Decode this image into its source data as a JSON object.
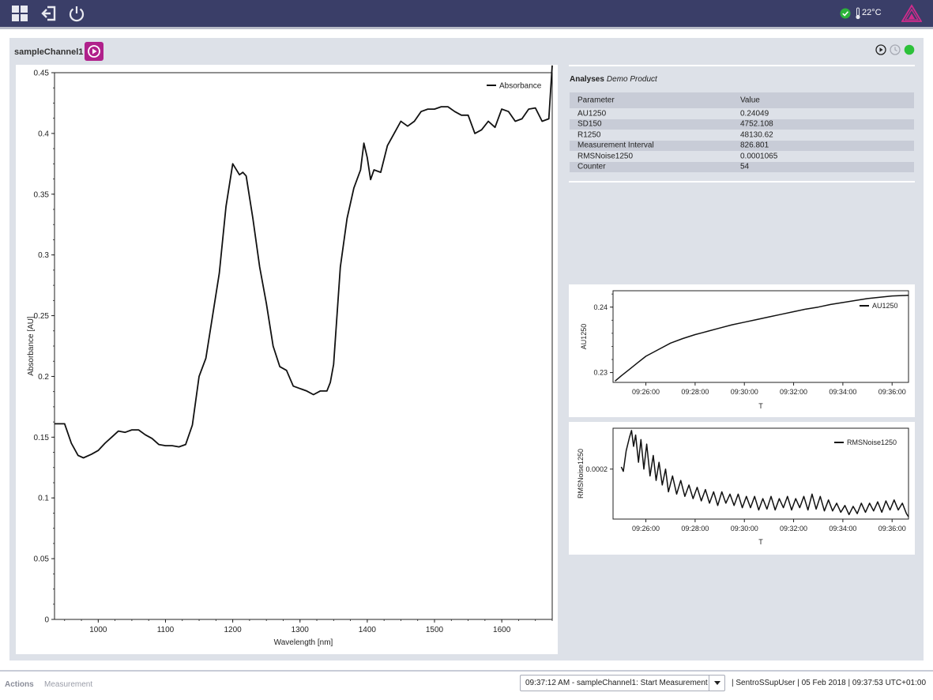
{
  "header": {
    "temperature": "22°C",
    "icons": [
      "dashboard-icon",
      "logout-icon",
      "power-icon",
      "status-ok-icon",
      "thermometer-icon",
      "brand-logo-icon"
    ]
  },
  "channel": {
    "name": "sampleChannel1"
  },
  "analyses": {
    "title": "Analyses",
    "product": "Demo Product",
    "columns": [
      "Parameter",
      "Value"
    ],
    "rows": [
      {
        "parameter": "AU1250",
        "value": "0.24049"
      },
      {
        "parameter": "SD150",
        "value": "4752.108"
      },
      {
        "parameter": "R1250",
        "value": "48130.62"
      },
      {
        "parameter": "Measurement Interval",
        "value": "826.801"
      },
      {
        "parameter": "RMSNoise1250",
        "value": "0.0001065"
      },
      {
        "parameter": "Counter",
        "value": "54"
      }
    ]
  },
  "chart_data": [
    {
      "type": "line",
      "xlabel": "Wavelength [nm]",
      "ylabel": "Absorbance [AU]",
      "legend": "top-right",
      "xlim": [
        935,
        1675
      ],
      "ylim": [
        0,
        0.45
      ],
      "xticks": [
        "1000",
        "1100",
        "1200",
        "1300",
        "1400",
        "1500",
        "1600"
      ],
      "yticks": [
        "0",
        "0.05",
        "0.1",
        "0.15",
        "0.2",
        "0.25",
        "0.3",
        "0.35",
        "0.4",
        "0.45"
      ],
      "series": [
        {
          "name": "Absorbance",
          "x": [
            935,
            950,
            960,
            970,
            978,
            990,
            1000,
            1010,
            1020,
            1030,
            1040,
            1050,
            1060,
            1070,
            1080,
            1090,
            1100,
            1110,
            1120,
            1130,
            1140,
            1150,
            1160,
            1170,
            1180,
            1190,
            1200,
            1210,
            1215,
            1220,
            1230,
            1240,
            1250,
            1260,
            1270,
            1280,
            1290,
            1300,
            1310,
            1320,
            1330,
            1340,
            1345,
            1350,
            1360,
            1370,
            1380,
            1390,
            1395,
            1400,
            1405,
            1410,
            1420,
            1430,
            1440,
            1450,
            1460,
            1470,
            1480,
            1490,
            1500,
            1510,
            1520,
            1530,
            1540,
            1550,
            1560,
            1570,
            1580,
            1590,
            1600,
            1610,
            1620,
            1630,
            1640,
            1650,
            1660,
            1670,
            1675
          ],
          "y": [
            0.161,
            0.161,
            0.145,
            0.135,
            0.133,
            0.136,
            0.139,
            0.145,
            0.15,
            0.155,
            0.154,
            0.156,
            0.156,
            0.152,
            0.149,
            0.144,
            0.143,
            0.143,
            0.142,
            0.144,
            0.16,
            0.2,
            0.215,
            0.25,
            0.285,
            0.34,
            0.375,
            0.366,
            0.368,
            0.365,
            0.33,
            0.29,
            0.26,
            0.225,
            0.208,
            0.205,
            0.192,
            0.19,
            0.188,
            0.185,
            0.188,
            0.188,
            0.195,
            0.21,
            0.29,
            0.33,
            0.355,
            0.37,
            0.392,
            0.38,
            0.362,
            0.37,
            0.368,
            0.39,
            0.4,
            0.41,
            0.406,
            0.41,
            0.418,
            0.42,
            0.42,
            0.422,
            0.422,
            0.418,
            0.415,
            0.415,
            0.4,
            0.403,
            0.41,
            0.405,
            0.42,
            0.418,
            0.41,
            0.412,
            0.42,
            0.421,
            0.41,
            0.412,
            0.456
          ]
        }
      ]
    },
    {
      "type": "line",
      "xlabel": "T",
      "ylabel": "AU1250",
      "legend": "top-right",
      "xlim": [
        "09:24:40",
        "09:36:40"
      ],
      "ylim": [
        0.2285,
        0.2425
      ],
      "xticks": [
        "09:26:00",
        "09:28:00",
        "09:30:00",
        "09:32:00",
        "09:34:00",
        "09:36:00"
      ],
      "yticks": [
        "0.23",
        "0.24"
      ],
      "series": [
        {
          "name": "AU1250",
          "x": [
            "09:24:45",
            "09:25:00",
            "09:25:20",
            "09:25:40",
            "09:26:00",
            "09:26:30",
            "09:27:00",
            "09:27:30",
            "09:28:00",
            "09:28:30",
            "09:29:00",
            "09:29:30",
            "09:30:00",
            "09:30:30",
            "09:31:00",
            "09:31:30",
            "09:32:00",
            "09:32:30",
            "09:33:00",
            "09:33:30",
            "09:34:00",
            "09:34:30",
            "09:35:00",
            "09:35:30",
            "09:36:00",
            "09:36:40"
          ],
          "y": [
            0.2287,
            0.2295,
            0.2305,
            0.2315,
            0.2325,
            0.2335,
            0.2345,
            0.2352,
            0.2358,
            0.2363,
            0.2368,
            0.2373,
            0.2377,
            0.2381,
            0.2385,
            0.2389,
            0.2393,
            0.2397,
            0.24,
            0.2404,
            0.2407,
            0.241,
            0.2413,
            0.2415,
            0.2417,
            0.2418
          ]
        }
      ]
    },
    {
      "type": "line",
      "xlabel": "T",
      "ylabel": "RMSNoise1250",
      "legend": "top-right",
      "xlim": [
        "09:24:40",
        "09:36:40"
      ],
      "ylim": [
        9e-05,
        0.00029
      ],
      "xticks": [
        "09:26:00",
        "09:28:00",
        "09:30:00",
        "09:32:00",
        "09:34:00",
        "09:36:00"
      ],
      "yticks": [
        "0.0002"
      ],
      "series": [
        {
          "name": "RMSNoise1250",
          "x": [
            "09:25:00",
            "09:25:05",
            "09:25:12",
            "09:25:20",
            "09:25:25",
            "09:25:30",
            "09:25:35",
            "09:25:42",
            "09:25:48",
            "09:25:55",
            "09:26:02",
            "09:26:10",
            "09:26:18",
            "09:26:25",
            "09:26:32",
            "09:26:40",
            "09:26:48",
            "09:26:55",
            "09:27:05",
            "09:27:15",
            "09:27:25",
            "09:27:35",
            "09:27:45",
            "09:27:55",
            "09:28:05",
            "09:28:15",
            "09:28:25",
            "09:28:35",
            "09:28:45",
            "09:28:55",
            "09:29:05",
            "09:29:15",
            "09:29:25",
            "09:29:35",
            "09:29:45",
            "09:29:55",
            "09:30:05",
            "09:30:15",
            "09:30:25",
            "09:30:35",
            "09:30:45",
            "09:30:55",
            "09:31:05",
            "09:31:15",
            "09:31:25",
            "09:31:35",
            "09:31:45",
            "09:31:55",
            "09:32:05",
            "09:32:15",
            "09:32:25",
            "09:32:35",
            "09:32:45",
            "09:32:55",
            "09:33:05",
            "09:33:15",
            "09:33:25",
            "09:33:35",
            "09:33:45",
            "09:33:55",
            "09:34:05",
            "09:34:15",
            "09:34:25",
            "09:34:35",
            "09:34:45",
            "09:34:55",
            "09:35:05",
            "09:35:15",
            "09:35:25",
            "09:35:35",
            "09:35:45",
            "09:35:55",
            "09:36:05",
            "09:36:15",
            "09:36:25",
            "09:36:35",
            "09:36:40"
          ],
          "y": [
            0.000205,
            0.000195,
            0.00024,
            0.00027,
            0.000285,
            0.00025,
            0.000275,
            0.000215,
            0.000265,
            0.0002,
            0.000255,
            0.000185,
            0.00023,
            0.000175,
            0.000215,
            0.000165,
            0.0002,
            0.00015,
            0.000185,
            0.000145,
            0.000175,
            0.00014,
            0.000165,
            0.000135,
            0.00016,
            0.00013,
            0.000155,
            0.000125,
            0.00015,
            0.00012,
            0.00015,
            0.000125,
            0.000145,
            0.00012,
            0.000145,
            0.000115,
            0.00014,
            0.000115,
            0.00014,
            0.00011,
            0.000135,
            0.000112,
            0.00014,
            0.00011,
            0.000135,
            0.000115,
            0.00014,
            0.00011,
            0.000135,
            0.000115,
            0.00014,
            0.00011,
            0.000145,
            0.000112,
            0.00014,
            0.000108,
            0.000132,
            0.000108,
            0.000125,
            0.000105,
            0.00012,
            0.0001,
            0.000118,
            0.000102,
            0.000125,
            0.000105,
            0.000125,
            0.000108,
            0.000128,
            0.000105,
            0.00013,
            0.00011,
            0.000132,
            0.00011,
            0.000125,
            0.000102,
            9.5e-05
          ]
        }
      ]
    }
  ],
  "footer": {
    "actions_label": "Actions",
    "measurement_label": "Measurement",
    "log_entry": "09:37:12 AM - sampleChannel1: Start Measurement",
    "info": "| SentroSSupUser | 05 Feb 2018  |  09:37:53 UTC+01:00"
  }
}
